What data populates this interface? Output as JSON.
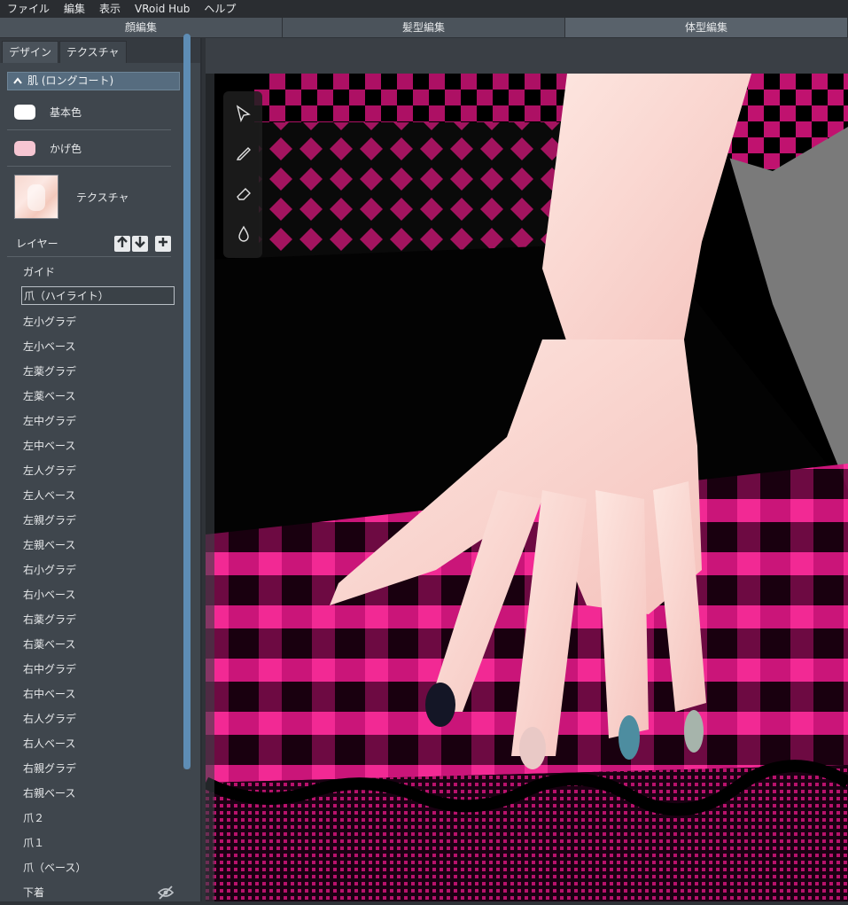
{
  "menu": [
    "ファイル",
    "編集",
    "表示",
    "VRoid Hub",
    "ヘルプ"
  ],
  "modes": [
    "顔編集",
    "髪型編集",
    "体型編集"
  ],
  "active_mode": 2,
  "subtabs": [
    "デザイン",
    "テクスチャ"
  ],
  "active_subtab": 1,
  "section": {
    "title": "肌 (ロングコート)"
  },
  "base_color": {
    "label": "基本色",
    "color": "#ffffff"
  },
  "shade_color": {
    "label": "かげ色",
    "color": "#f6c6d2"
  },
  "texture": {
    "label": "テクスチャ"
  },
  "layers": {
    "title": "レイヤー",
    "items": [
      "ガイド",
      "爪（ハイライト）",
      "左小グラデ",
      "左小ベース",
      "左薬グラデ",
      "左薬ベース",
      "左中グラデ",
      "左中ベース",
      "左人グラデ",
      "左人ベース",
      "左親グラデ",
      "左親ベース",
      "右小グラデ",
      "右小ベース",
      "右薬グラデ",
      "右薬ベース",
      "右中グラデ",
      "右中ベース",
      "右人グラデ",
      "右人ベース",
      "右親グラデ",
      "右親ベース",
      "爪２",
      "爪１",
      "爪（ベース）",
      "下着"
    ],
    "selected_index": 1,
    "hidden_index": 25
  },
  "colors": {
    "nail_black": "#141626",
    "nail_pink": "#e9c9c6",
    "nail_teal": "#4d8da0",
    "nail_sage": "#a6b4ab",
    "skirt_magenta": "#d4167f",
    "skin": "#fbd6cf"
  }
}
